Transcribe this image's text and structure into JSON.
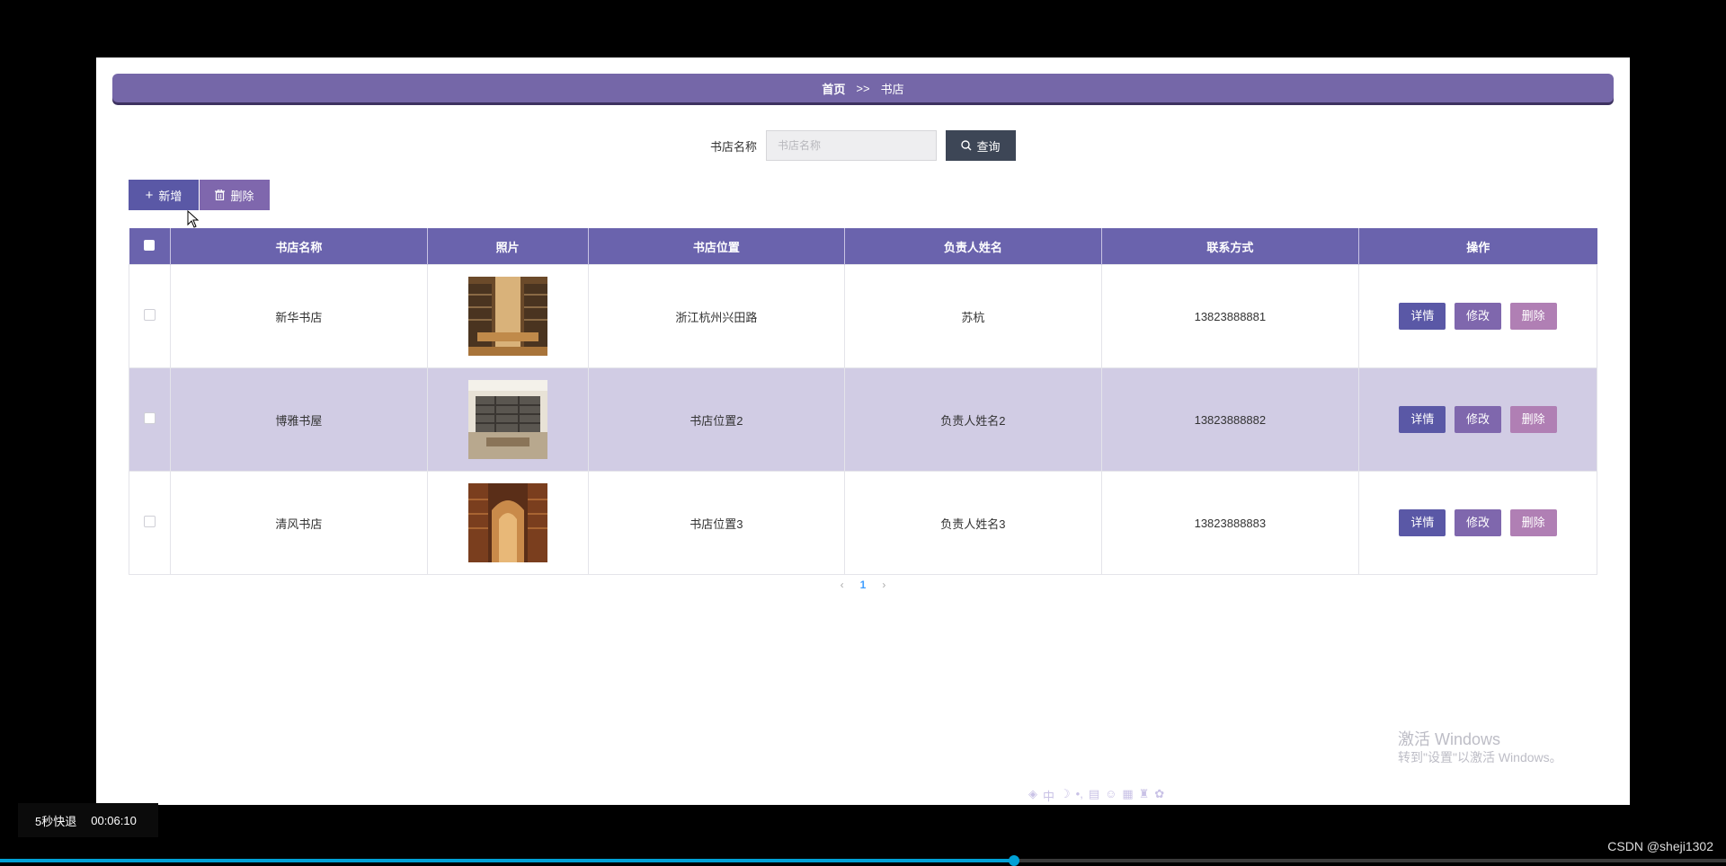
{
  "breadcrumb": {
    "home": "首页",
    "separator": ">>",
    "current": "书店"
  },
  "search": {
    "label": "书店名称",
    "placeholder": "书店名称",
    "button_label": "查询"
  },
  "actions": {
    "add_label": "新增",
    "delete_label": "删除"
  },
  "table": {
    "columns": [
      "书店名称",
      "照片",
      "书店位置",
      "负责人姓名",
      "联系方式",
      "操作"
    ],
    "rows": [
      {
        "name": "新华书店",
        "location": "浙江杭州兴田路",
        "manager": "苏杭",
        "phone": "13823888881"
      },
      {
        "name": "博雅书屋",
        "location": "书店位置2",
        "manager": "负责人姓名2",
        "phone": "13823888882"
      },
      {
        "name": "清风书店",
        "location": "书店位置3",
        "manager": "负责人姓名3",
        "phone": "13823888883"
      }
    ],
    "op_labels": {
      "detail": "详情",
      "edit": "修改",
      "remove": "删除"
    }
  },
  "pagination": {
    "prev": "‹",
    "current": "1",
    "next": "›"
  },
  "watermark": {
    "line1": "激活 Windows",
    "line2": "转到\"设置\"以激活 Windows。"
  },
  "player": {
    "speed_label": "5秒快退",
    "time": "00:06:10",
    "credit": "CSDN @sheji1302"
  },
  "colors": {
    "header": "#6a63ad",
    "breadcrumb": "#7567a8",
    "row_highlight": "#d1cce4",
    "search_button": "#3d4656"
  }
}
